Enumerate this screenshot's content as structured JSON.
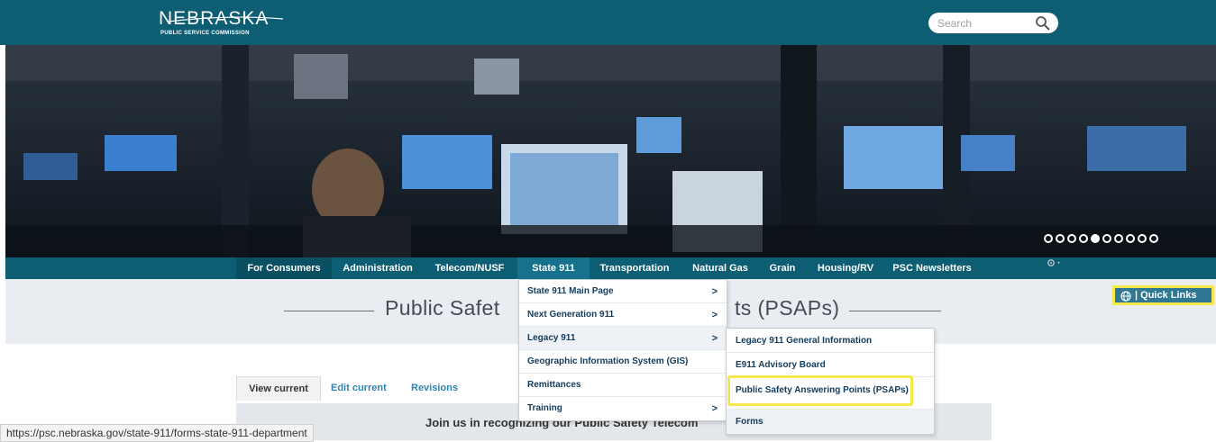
{
  "header": {
    "logo_name": "NEBRASKA",
    "logo_sub": "PUBLIC SERVICE COMMISSION",
    "search_placeholder": "Search",
    "brand_color": "#0d5d73"
  },
  "hero": {
    "slide_count": 10,
    "active_slide": 5
  },
  "nav": {
    "items": [
      {
        "label": "For Consumers"
      },
      {
        "label": "Administration"
      },
      {
        "label": "Telecom/NUSF"
      },
      {
        "label": "State 911"
      },
      {
        "label": "Transportation"
      },
      {
        "label": "Natural Gas"
      },
      {
        "label": "Grain"
      },
      {
        "label": "Housing/RV"
      },
      {
        "label": "PSC Newsletters"
      }
    ],
    "settings_icon": "gear-icon"
  },
  "page": {
    "title_left": "Public Safet",
    "title_right": "ts (PSAPs)",
    "quick_links": "| Quick Links",
    "banner": "Join us in recognizing our Public Safety Telecom"
  },
  "tabs": [
    {
      "label": "View current"
    },
    {
      "label": "Edit current"
    },
    {
      "label": "Revisions"
    }
  ],
  "dropdown": {
    "items": [
      {
        "label": "State 911 Main Page",
        "chevron": ">"
      },
      {
        "label": "Next Generation 911",
        "chevron": ">"
      },
      {
        "label": "Legacy 911",
        "chevron": ">"
      },
      {
        "label": "Geographic Information System (GIS)",
        "chevron": ""
      },
      {
        "label": "Remittances",
        "chevron": ""
      },
      {
        "label": "Training",
        "chevron": ">"
      }
    ]
  },
  "submenu": {
    "items": [
      {
        "label": "Legacy 911 General Information"
      },
      {
        "label": "E911 Advisory Board"
      },
      {
        "label": "Public Safety Answering Points (PSAPs)"
      },
      {
        "label": "Forms"
      }
    ],
    "highlight_color": "#f5e74c"
  },
  "status_bar": {
    "url": "https://psc.nebraska.gov/state-911/forms-state-911-department"
  }
}
